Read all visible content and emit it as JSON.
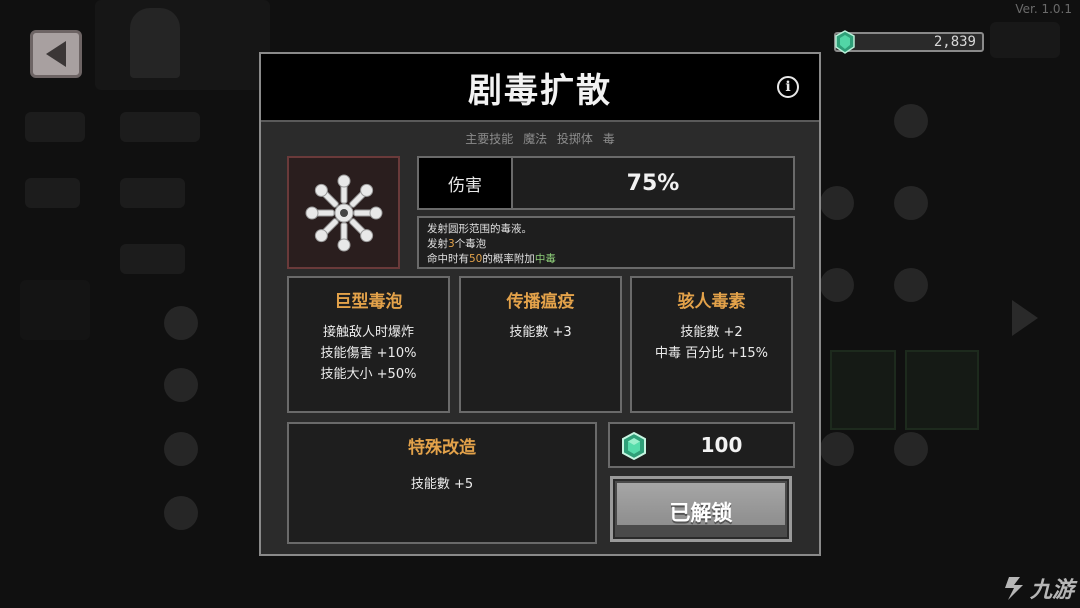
{
  "version": "Ver. 1.0.1",
  "currency": {
    "amount": "2,839",
    "icon": "emerald-gem-icon"
  },
  "back_button": {
    "icon": "back-arrow-icon"
  },
  "skill": {
    "title": "剧毒扩散",
    "tags": [
      "主要技能",
      "魔法",
      "投掷体",
      "毒"
    ],
    "icon": "poison-burst-icon",
    "damage_label": "伤害",
    "damage_value": "75%",
    "description": {
      "line1": "发射圆形范围的毒液。",
      "line2_prefix": "发射",
      "line2_count": "3",
      "line2_suffix": "个毒泡",
      "line3_prefix": "命中时有",
      "line3_chance": "50",
      "line3_mid": "的概率附加",
      "line3_effect": "中毒"
    }
  },
  "upgrades": [
    {
      "title": "巨型毒泡",
      "lines": [
        "接触敌人时爆炸",
        "技能傷害 +10%",
        "技能大小 +50%"
      ]
    },
    {
      "title": "传播瘟疫",
      "lines": [
        "技能數 +3"
      ]
    },
    {
      "title": "骇人毒素",
      "lines": [
        "技能數 +2",
        "中毒 百分比 +15%"
      ]
    }
  ],
  "special": {
    "title": "特殊改造",
    "lines": [
      "技能數 +5"
    ]
  },
  "cost": {
    "amount": "100",
    "icon": "emerald-gem-icon"
  },
  "unlock_button": {
    "label": "已解锁"
  },
  "watermark": {
    "text": "九游"
  },
  "colors": {
    "accent_orange": "#e3a24a",
    "accent_green": "#8fd07a",
    "gem": "#3fbf8f"
  }
}
